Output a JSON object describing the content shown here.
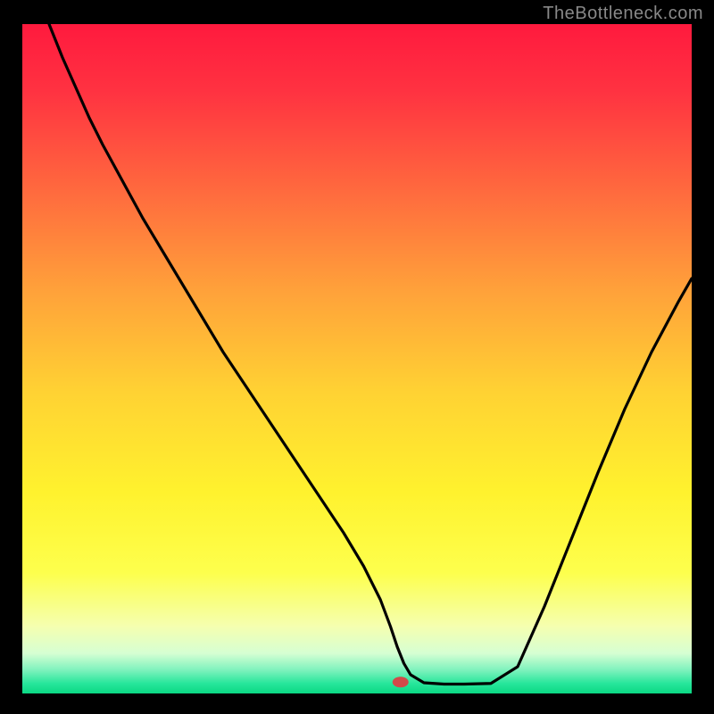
{
  "watermark": "TheBottleneck.com",
  "chart_data": {
    "type": "line",
    "title": "",
    "xlabel": "",
    "ylabel": "",
    "xlim": [
      0,
      100
    ],
    "ylim": [
      0,
      100
    ],
    "grid": false,
    "background_gradient": {
      "stops": [
        {
          "offset": 0.0,
          "color": "#ff1a3e"
        },
        {
          "offset": 0.1,
          "color": "#ff3241"
        },
        {
          "offset": 0.25,
          "color": "#ff6a3e"
        },
        {
          "offset": 0.4,
          "color": "#ffa23a"
        },
        {
          "offset": 0.55,
          "color": "#ffd233"
        },
        {
          "offset": 0.7,
          "color": "#fff22e"
        },
        {
          "offset": 0.82,
          "color": "#fdff4d"
        },
        {
          "offset": 0.9,
          "color": "#f5ffb0"
        },
        {
          "offset": 0.94,
          "color": "#d6ffd3"
        },
        {
          "offset": 0.965,
          "color": "#7ef2bd"
        },
        {
          "offset": 0.985,
          "color": "#27e69b"
        },
        {
          "offset": 1.0,
          "color": "#0bd884"
        }
      ]
    },
    "series": [
      {
        "name": "bottleneck-curve",
        "x": [
          4,
          6,
          8,
          10,
          12,
          15,
          18,
          21,
          24,
          27,
          30,
          33,
          36,
          39,
          42,
          45,
          48,
          51,
          53.5,
          55,
          56,
          57,
          58,
          60,
          63,
          66,
          70,
          74,
          78,
          82,
          86,
          90,
          94,
          98,
          100
        ],
        "y": [
          100,
          95,
          90.5,
          86,
          82,
          76.5,
          71,
          66,
          61,
          56,
          51,
          46.5,
          42,
          37.5,
          33,
          28.5,
          24,
          19,
          14,
          10,
          7,
          4.5,
          2.8,
          1.6,
          1.4,
          1.4,
          1.5,
          4,
          13,
          23,
          33,
          42.5,
          51,
          58.5,
          62
        ]
      }
    ],
    "marker": {
      "name": "min-point",
      "x": 56.5,
      "y": 1.7,
      "color": "#d24a4a",
      "rx": 9,
      "ry": 6
    }
  }
}
